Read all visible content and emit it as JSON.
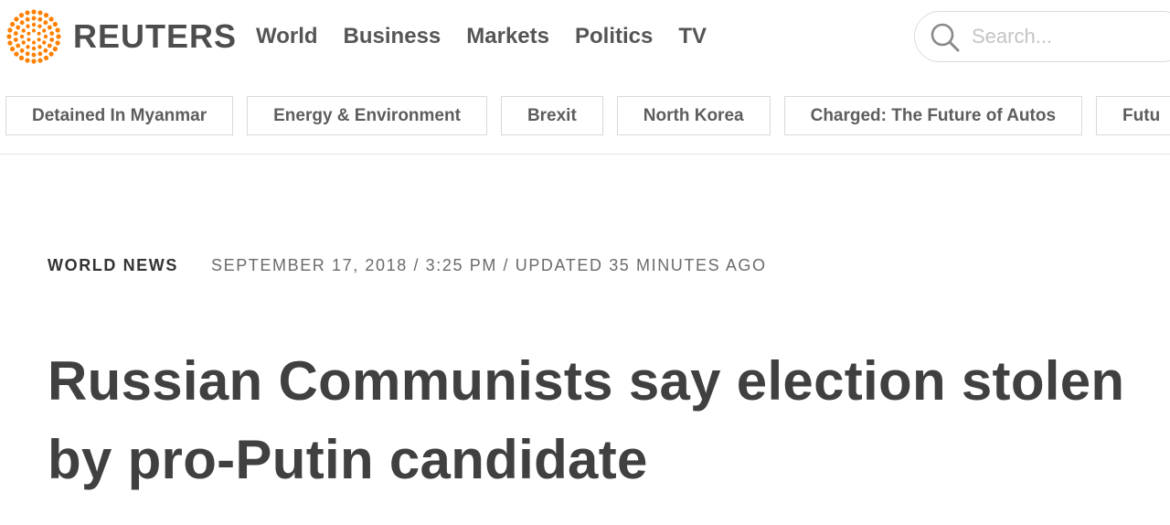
{
  "brand": {
    "name": "REUTERS",
    "accent": "#ff8000"
  },
  "nav": [
    "World",
    "Business",
    "Markets",
    "Politics",
    "TV"
  ],
  "search": {
    "placeholder": "Search..."
  },
  "topics": [
    "Detained In Myanmar",
    "Energy & Environment",
    "Brexit",
    "North Korea",
    "Charged: The Future of Autos",
    "Futu"
  ],
  "article": {
    "section": "WORLD NEWS",
    "date": "SEPTEMBER 17, 2018 / 3:25 PM / UPDATED 35 MINUTES AGO",
    "headline_line1": "Russian Communists say election stolen",
    "headline_line2": "by pro-Putin candidate"
  },
  "icons": {
    "logo": "reuters-logo-icon",
    "search": "search-icon"
  }
}
